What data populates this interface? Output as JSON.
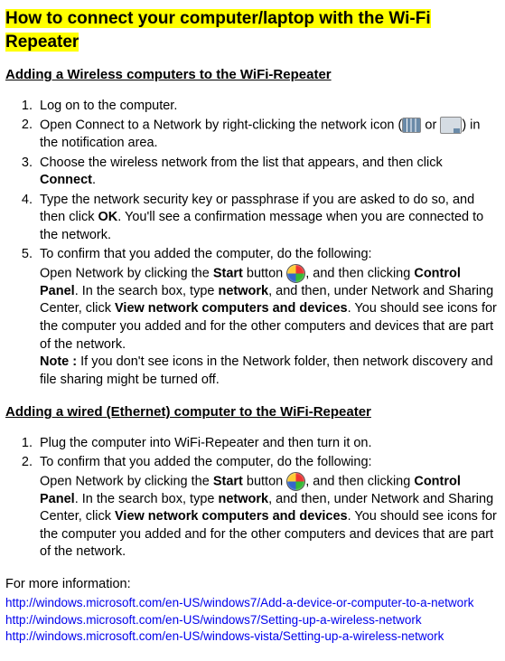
{
  "title_line1": "How to connect your computer/laptop with the Wi-Fi",
  "title_line2": "Repeater",
  "section1": {
    "heading": "Adding a Wireless computers to the WiFi-Repeater",
    "items": {
      "i1": "Log on to the computer.",
      "i2a": "Open Connect to a Network by right-clicking the network icon (",
      "i2b": " or ",
      "i2c": ") in the notification area.",
      "i3a": "Choose the wireless network from the list that appears, and then click ",
      "i3b": "Connect",
      "i3c": ".",
      "i4a": "Type the network security key or passphrase if you are asked to do so, and then click ",
      "i4b": "OK",
      "i4c": ". You'll see a confirmation message when you are connected to the network.",
      "i5a": "To confirm that you added the computer, do the following:",
      "i5b": "Open Network by clicking the ",
      "i5c": "Start",
      "i5d": " button ",
      "i5e": ", and then clicking ",
      "i5f": "Control Panel",
      "i5g": ". In the search box, type ",
      "i5h": "network",
      "i5i": ", and then, under Network and Sharing Center, click ",
      "i5j": "View network computers and devices",
      "i5k": ". You should see icons for the computer you added and for the other computers and devices that are part of the network.",
      "i5l": "Note : ",
      "i5m": "If you don't see icons in the Network folder, then network discovery and file sharing might be turned off."
    }
  },
  "section2": {
    "heading": "Adding a wired (Ethernet) computer to the WiFi-Repeater",
    "items": {
      "i1": "Plug the computer into WiFi-Repeater and then turn it on.",
      "i2a": "To confirm that you added the computer, do the following:",
      "i2b": "Open Network by clicking the ",
      "i2c": "Start",
      "i2d": " button ",
      "i2e": ", and then clicking ",
      "i2f": "Control Panel",
      "i2g": ". In the search box, type ",
      "i2h": "network",
      "i2i": ", and then, under Network and Sharing Center, click ",
      "i2j": "View network computers and devices",
      "i2k": ".  You should see icons for the computer you added and for the other computers and devices that are part of the network."
    }
  },
  "moreinfo": "For more information:",
  "links": {
    "l1": "http://windows.microsoft.com/en-US/windows7/Add-a-device-or-computer-to-a-network",
    "l2": "http://windows.microsoft.com/en-US/windows7/Setting-up-a-wireless-network",
    "l3": "http://windows.microsoft.com/en-US/windows-vista/Setting-up-a-wireless-network"
  }
}
